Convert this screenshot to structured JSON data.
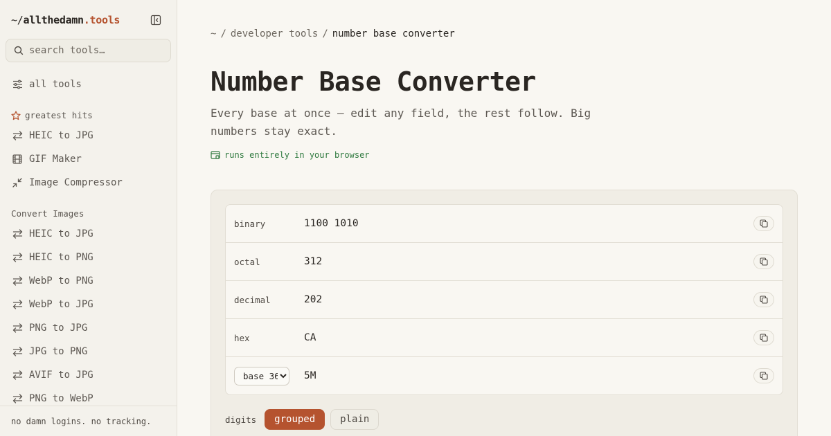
{
  "brand": {
    "prefix": "~/",
    "name": "allthedamn",
    "tld": ".tools"
  },
  "search": {
    "placeholder": "search tools…"
  },
  "nav": {
    "all_tools": {
      "label": "all tools",
      "icon": "sliders-icon"
    },
    "greatest_hits": {
      "label": "greatest hits",
      "items": [
        {
          "label": "HEIC to JPG",
          "icon": "arrows-exchange-icon"
        },
        {
          "label": "GIF Maker",
          "icon": "film-icon"
        },
        {
          "label": "Image Compressor",
          "icon": "compress-icon"
        }
      ]
    },
    "convert_images": {
      "label": "Convert Images",
      "items": [
        {
          "label": "HEIC to JPG",
          "icon": "arrows-exchange-icon"
        },
        {
          "label": "HEIC to PNG",
          "icon": "arrows-exchange-icon"
        },
        {
          "label": "WebP to PNG",
          "icon": "arrows-exchange-icon"
        },
        {
          "label": "WebP to JPG",
          "icon": "arrows-exchange-icon"
        },
        {
          "label": "PNG to JPG",
          "icon": "arrows-exchange-icon"
        },
        {
          "label": "JPG to PNG",
          "icon": "arrows-exchange-icon"
        },
        {
          "label": "AVIF to JPG",
          "icon": "arrows-exchange-icon"
        },
        {
          "label": "PNG to WebP",
          "icon": "arrows-exchange-icon"
        }
      ]
    }
  },
  "footer": {
    "text": "no damn logins. no tracking."
  },
  "breadcrumb": {
    "root": "~",
    "parent": "developer tools",
    "current": "number base converter",
    "sep": "/"
  },
  "page": {
    "title": "Number Base Converter",
    "subtitle": "Every base at once — edit any field, the rest follow. Big numbers stay exact.",
    "privacy": "runs entirely in your browser"
  },
  "converter": {
    "rows": [
      {
        "label": "binary",
        "value": "1100 1010"
      },
      {
        "label": "octal",
        "value": "312"
      },
      {
        "label": "decimal",
        "value": "202"
      },
      {
        "label": "hex",
        "value": "CA"
      }
    ],
    "custom": {
      "selected_base": "base 36",
      "value": "5M"
    },
    "digits": {
      "label": "digits",
      "options": [
        "grouped",
        "plain"
      ],
      "selected": "grouped"
    }
  },
  "colors": {
    "accent": "#b5532f",
    "privacy_green": "#2f7a3f",
    "background": "#f9f7f2"
  }
}
